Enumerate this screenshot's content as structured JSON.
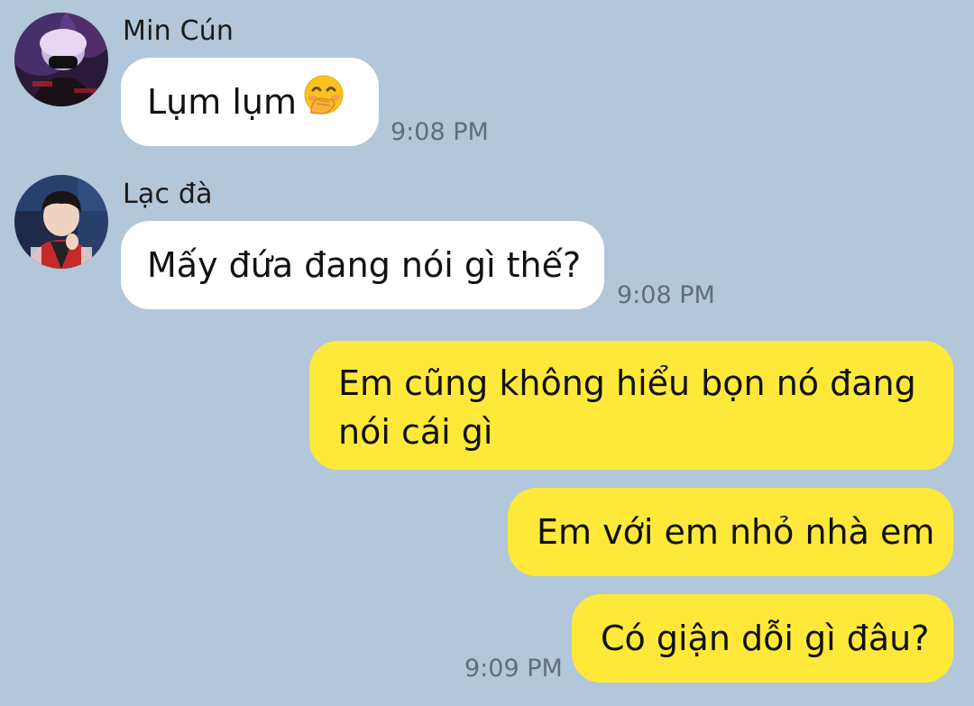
{
  "chat": {
    "messages": [
      {
        "sender": "Min Cún",
        "text": "Lụm lụm",
        "emoji": "hand-over-mouth-emoji",
        "time": "9:08 PM",
        "direction": "incoming"
      },
      {
        "sender": "Lạc đà",
        "text": "Mấy đứa đang nói gì thế?",
        "time": "9:08 PM",
        "direction": "incoming"
      },
      {
        "lines": [
          "Em cũng không hiểu bọn nó đang",
          "nói cái gì"
        ],
        "direction": "outgoing"
      },
      {
        "text": "Em với em nhỏ nhà em",
        "direction": "outgoing"
      },
      {
        "text": "Có giận dỗi gì đâu?",
        "time": "9:09 PM",
        "direction": "outgoing"
      }
    ]
  },
  "colors": {
    "background": "#b2c7d9",
    "incoming_bubble": "#ffffff",
    "outgoing_bubble": "#fee93a",
    "timestamp": "#5e6e7c"
  }
}
